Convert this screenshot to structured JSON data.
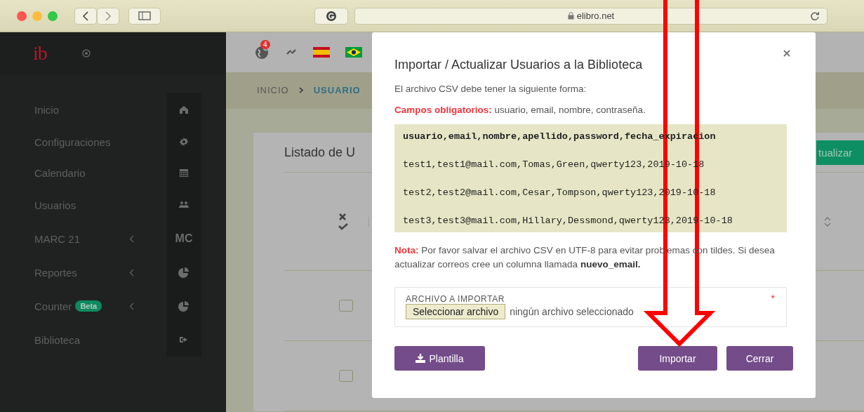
{
  "browser": {
    "url": "elibro.net"
  },
  "sidebar": {
    "logo": "ib",
    "items": [
      {
        "label": "Inicio",
        "submenu": false
      },
      {
        "label": "Configuraciones",
        "submenu": false
      },
      {
        "label": "Calendario",
        "submenu": false
      },
      {
        "label": "Usuarios",
        "submenu": false
      },
      {
        "label": "MARC 21",
        "submenu": true,
        "icon_text": "MC"
      },
      {
        "label": "Reportes",
        "submenu": true
      },
      {
        "label": "Counter",
        "submenu": true,
        "badge": "Beta"
      },
      {
        "label": "Biblioteca",
        "submenu": false
      }
    ]
  },
  "header": {
    "notification_count": "4"
  },
  "breadcrumb": [
    "INICIO",
    "USUARIO"
  ],
  "card": {
    "title": "Listado de U",
    "action_button": "tualizar",
    "rows": [
      {
        "checked": false
      },
      {
        "checked": false
      }
    ]
  },
  "modal": {
    "title": "Importar / Actualizar Usuarios a la Biblioteca",
    "intro": "El archivo CSV debe tener la siguiente forma:",
    "required": "**Campos obligatorios:** usuario, email, nombre, contraseña.",
    "code_lines": [
      {
        "kind": "header",
        "text": "usuario,email,nombre,apellido,password,fecha_expiracion"
      },
      {
        "kind": "row",
        "text": "test1,test1@mail.com,Tomas,Green,qwerty123,2019-10-18"
      },
      {
        "kind": "row",
        "text": "test2,test2@mail.com,Cesar,Tompson,qwerty123,2019-10-18"
      },
      {
        "kind": "row",
        "text": "test3,test3@mail.com,Hillary,Dessmond,qwerty123,2019-10-18"
      }
    ],
    "note": "**Nota:** Por favor salvar el archivo CSV en UTF-8 para evitar problemas con tildes. Si desea actualizar correos cree un columna llamada **nuevo_email.**",
    "file_field": {
      "label": "ARCHIVO A IMPORTAR",
      "required": true,
      "required_mark": "*",
      "button": "Seleccionar archivo",
      "status": "ningún archivo seleccionado"
    },
    "buttons": [
      {
        "label": "Plantilla",
        "kind": "download"
      },
      {
        "label": "Importar",
        "kind": "plain"
      },
      {
        "label": "Cerrar",
        "kind": "plain"
      }
    ]
  }
}
